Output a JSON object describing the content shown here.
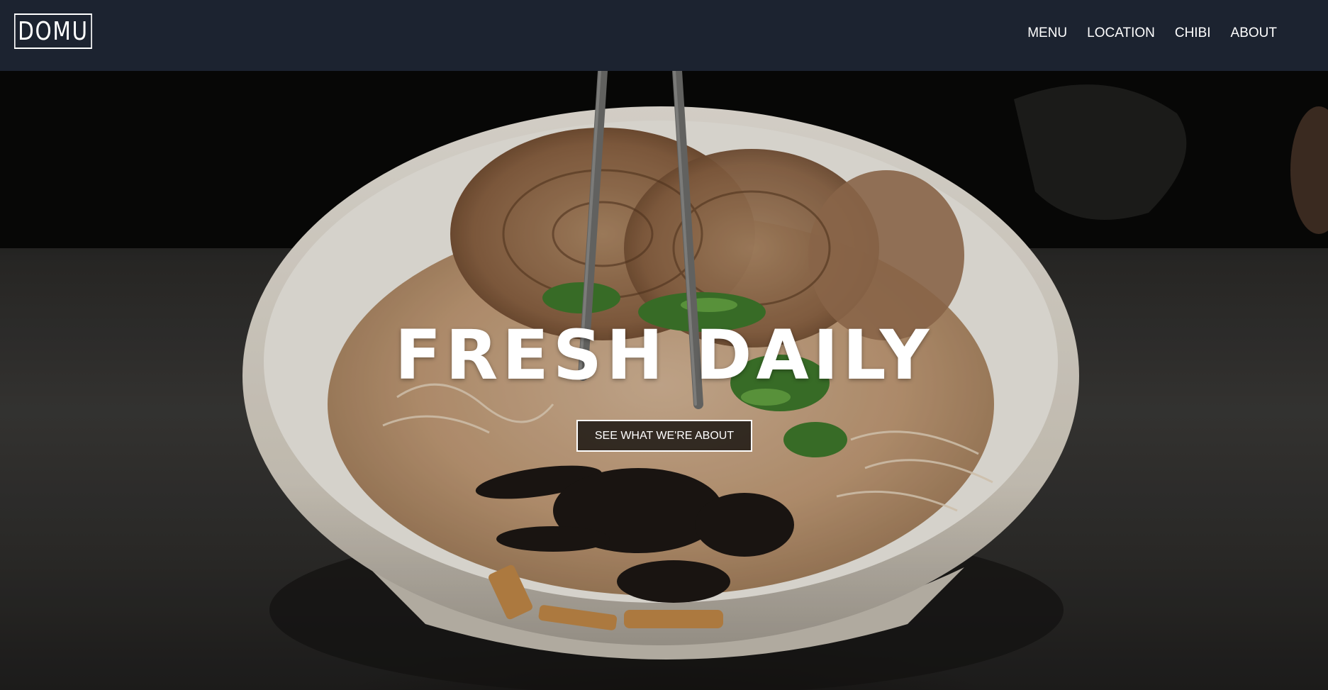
{
  "brand": {
    "logo_text": "DOMU"
  },
  "nav": {
    "items": [
      {
        "label": "MENU"
      },
      {
        "label": "LOCATION"
      },
      {
        "label": "CHIBI"
      },
      {
        "label": "ABOUT"
      }
    ]
  },
  "hero": {
    "title": "FRESH DAILY",
    "cta_label": "SEE WHAT WE'RE ABOUT",
    "background_image": "ramen-bowl-photo"
  },
  "colors": {
    "navbar_bg": "#1c2330",
    "text": "#ffffff",
    "bowl": "#e9e4da",
    "broth": "#c9a582"
  }
}
